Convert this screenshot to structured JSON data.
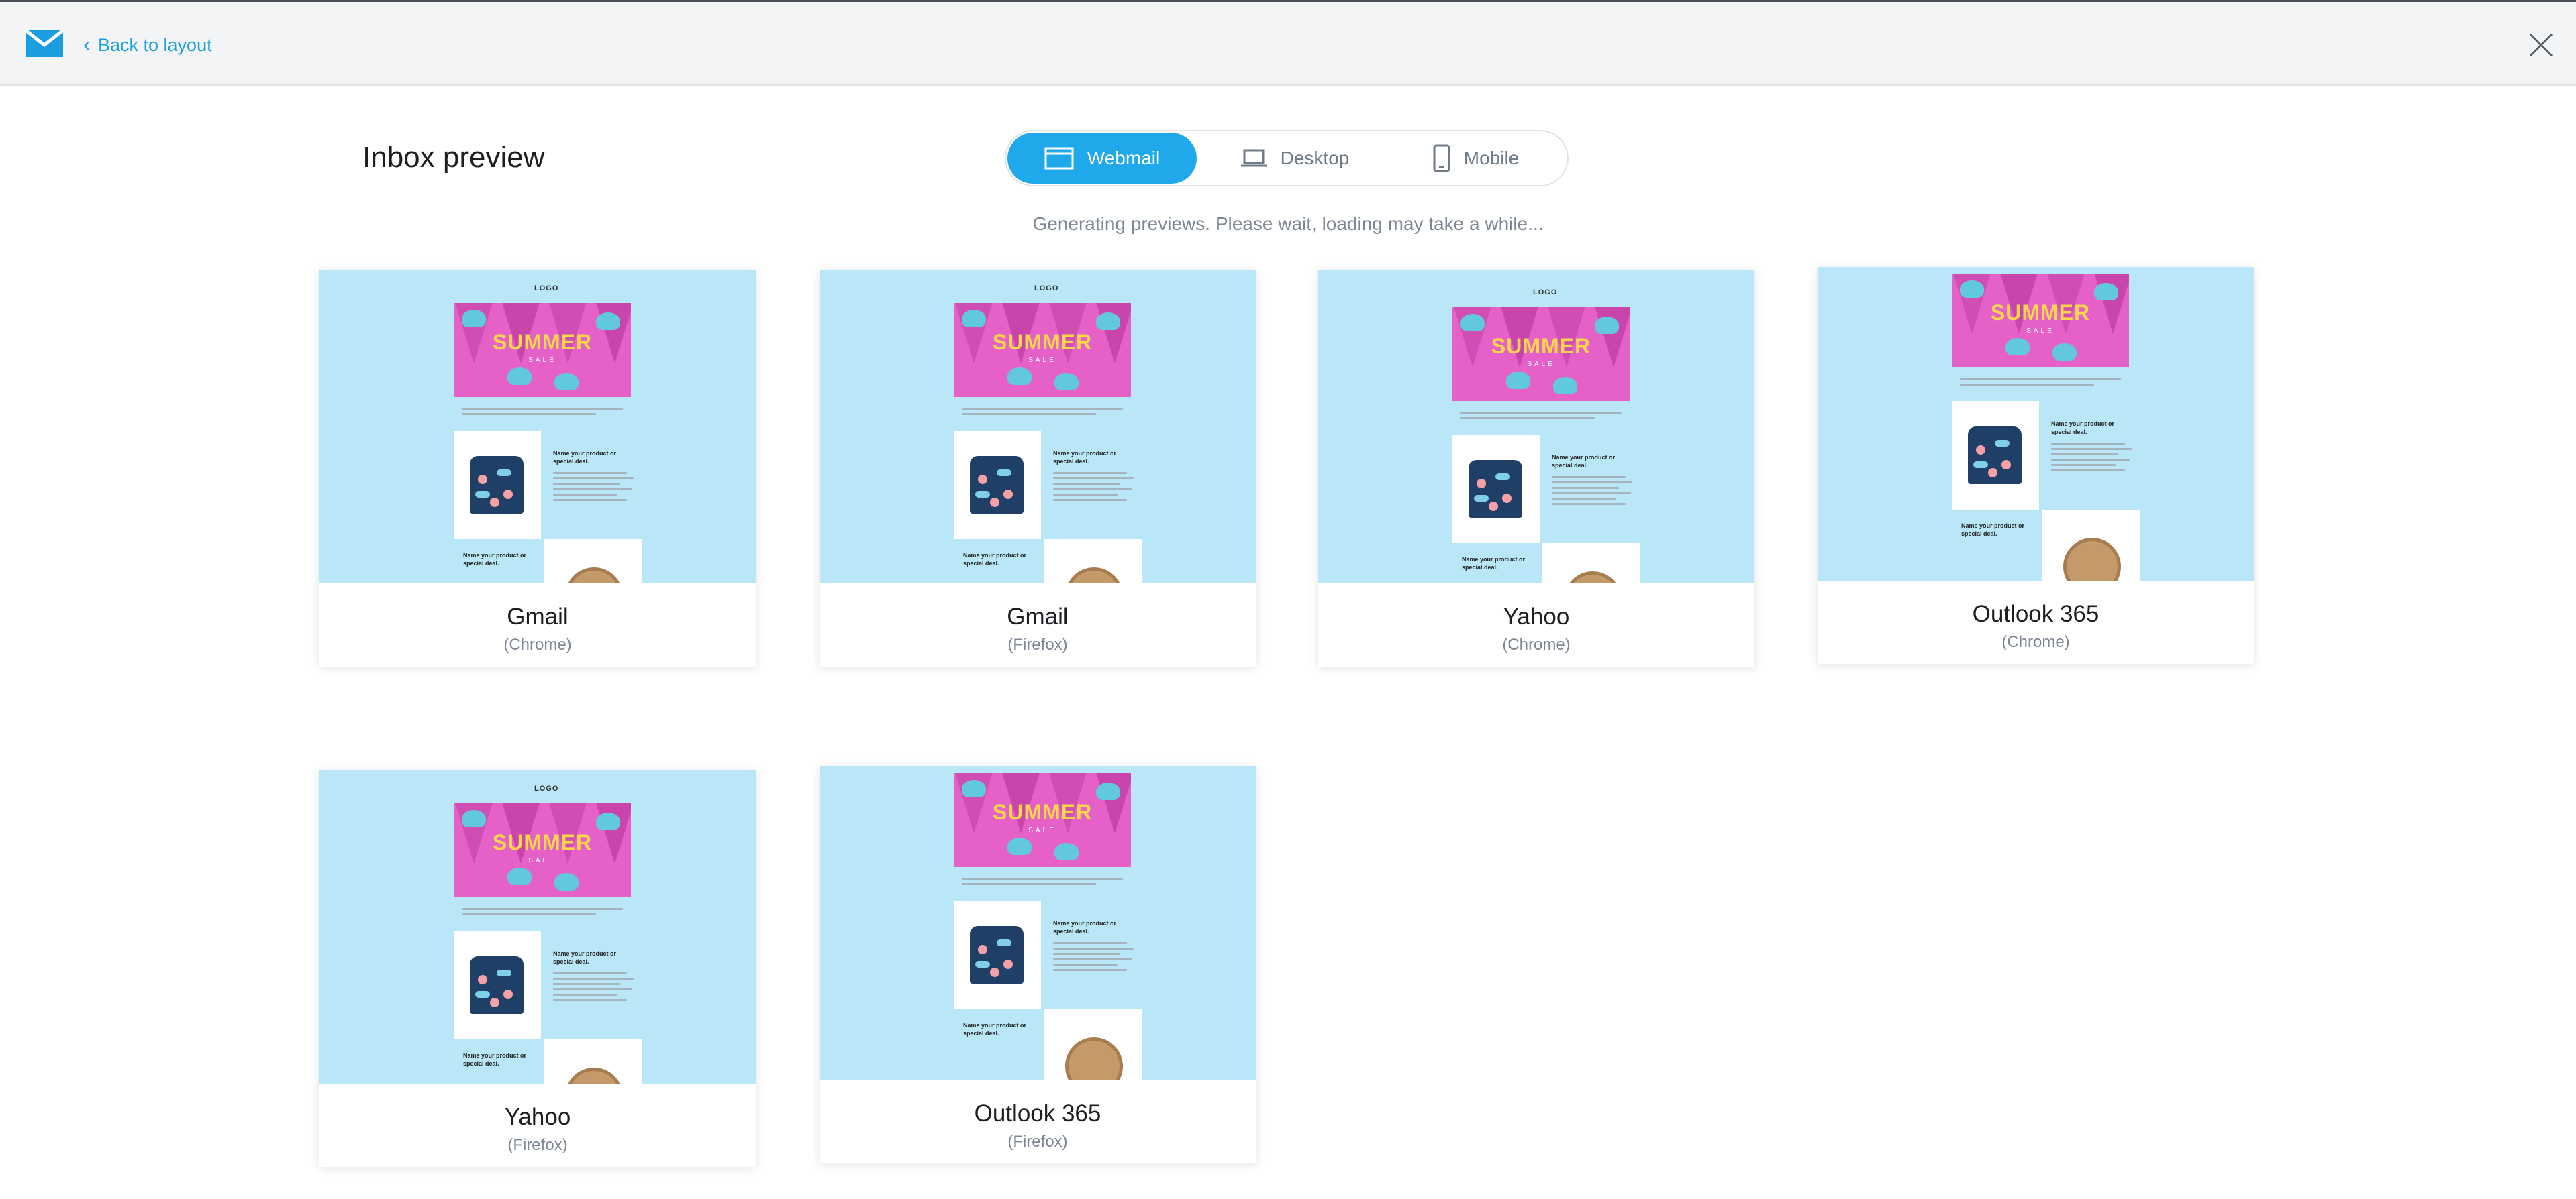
{
  "header": {
    "back_label": "Back to layout"
  },
  "page": {
    "title": "Inbox preview",
    "status": "Generating previews. Please wait, loading may take a while..."
  },
  "tabs": [
    {
      "label": "Webmail",
      "active": true
    },
    {
      "label": "Desktop",
      "active": false
    },
    {
      "label": "Mobile",
      "active": false
    }
  ],
  "previews": [
    {
      "client": "Gmail",
      "browser": "(Chrome)"
    },
    {
      "client": "Gmail",
      "browser": "(Firefox)"
    },
    {
      "client": "Yahoo",
      "browser": "(Chrome)"
    },
    {
      "client": "Outlook 365",
      "browser": "(Chrome)"
    },
    {
      "client": "Yahoo",
      "browser": "(Firefox)"
    },
    {
      "client": "Outlook 365",
      "browser": "(Firefox)"
    }
  ],
  "email": {
    "logo": "LOGO",
    "banner_title": "SUMMER",
    "banner_sub": "SALE",
    "product_name": "Name your product or special deal."
  },
  "colors": {
    "accent": "#1fa9ea",
    "thumb_bg": "#b9e7f8",
    "banner": "#e561c8",
    "banner_text": "#ffd84a"
  },
  "icons": {
    "logo": "envelope-logo-icon",
    "back": "chevron-left-icon",
    "close": "close-icon",
    "webmail": "browser-window-icon",
    "desktop": "laptop-icon",
    "mobile": "phone-icon"
  }
}
